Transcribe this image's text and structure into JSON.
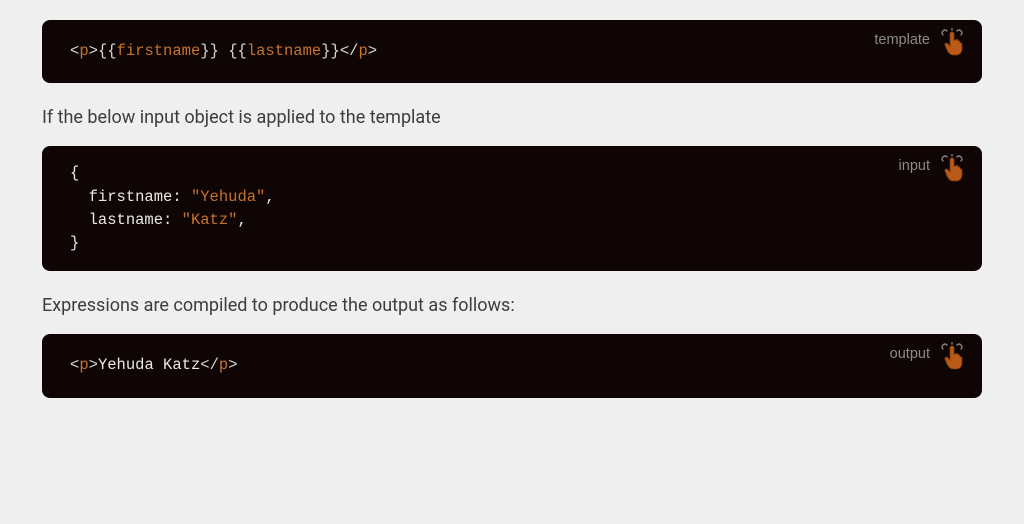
{
  "blocks": [
    {
      "label": "template",
      "type": "template",
      "code": {
        "tag": "p",
        "expr1": "firstname",
        "expr2": "lastname"
      }
    },
    {
      "label": "input",
      "type": "input",
      "code": {
        "key1": "firstname:",
        "val1": "\"Yehuda\"",
        "comma1": ",",
        "key2": "lastname:",
        "val2": "\"Katz\"",
        "comma2": ","
      }
    },
    {
      "label": "output",
      "type": "output",
      "code": {
        "tag": "p",
        "content": "Yehuda Katz"
      }
    }
  ],
  "prose": {
    "p1": "If the below input object is applied to the template",
    "p2": "Expressions are compiled to produce the output as follows:"
  },
  "icons": {
    "click": "pointer-hand"
  }
}
